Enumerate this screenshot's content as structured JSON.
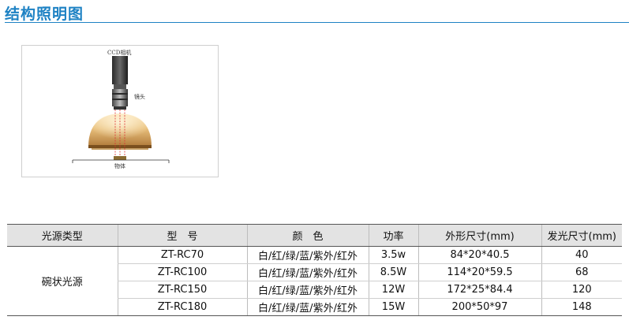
{
  "page": {
    "title": "结构照明图"
  },
  "diagram": {
    "camera_label": "CCD相机",
    "lens_label": "镜头",
    "object_label": "物体"
  },
  "table": {
    "headers": [
      "光源类型",
      "型　号",
      "颜　色",
      "功率",
      "外形尺寸(mm)",
      "发光尺寸(mm)"
    ],
    "type_value": "碗状光源",
    "rows": [
      {
        "model": "ZT-RC70",
        "color": "白/红/绿/蓝/紫外/红外",
        "power": "3.5w",
        "dims": "84*20*40.5",
        "emit": "40"
      },
      {
        "model": "ZT-RC100",
        "color": "白/红/绿/蓝/紫外/红外",
        "power": "8.5W",
        "dims": "114*20*59.5",
        "emit": "68"
      },
      {
        "model": "ZT-RC150",
        "color": "白/红/绿/蓝/紫外/红外",
        "power": "12W",
        "dims": "172*25*84.4",
        "emit": "120"
      },
      {
        "model": "ZT-RC180",
        "color": "白/红/绿/蓝/紫外/红外",
        "power": "15W",
        "dims": "200*50*97",
        "emit": "148"
      }
    ]
  }
}
